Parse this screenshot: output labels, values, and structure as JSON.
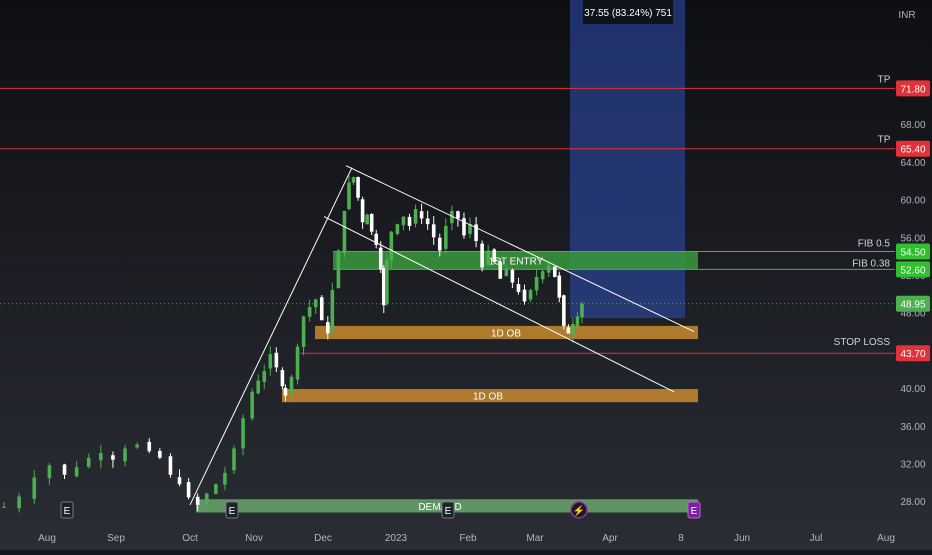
{
  "chart_data": {
    "type": "candlestick",
    "currency": "INR",
    "ylim": [
      26,
      78
    ],
    "y_ticks": [
      "28.00",
      "32.00",
      "36.00",
      "40.00",
      "44.00",
      "48.00",
      "52.00",
      "56.00",
      "60.00",
      "64.00",
      "68.00"
    ],
    "x_ticks": [
      "Aug",
      "Sep",
      "Oct",
      "Nov",
      "Dec",
      "2023",
      "Feb",
      "Mar",
      "Apr",
      "8",
      "Jun",
      "Jul",
      "Aug"
    ],
    "last_price": "48.95",
    "price_path": [
      [
        0,
        27.4
      ],
      [
        10,
        28.5
      ],
      [
        20,
        30.5
      ],
      [
        30,
        31.8
      ],
      [
        40,
        30.8
      ],
      [
        48,
        31.6
      ],
      [
        56,
        32.6
      ],
      [
        64,
        33.1
      ],
      [
        72,
        32.4
      ],
      [
        80,
        33.6
      ],
      [
        88,
        34.0
      ],
      [
        96,
        33.3
      ],
      [
        103,
        32.6
      ],
      [
        110,
        30.8
      ],
      [
        116,
        29.8
      ],
      [
        122,
        28.4
      ],
      [
        128,
        27.6
      ],
      [
        134,
        28.8
      ],
      [
        140,
        29.8
      ],
      [
        146,
        31.0
      ],
      [
        152,
        33.6
      ],
      [
        158,
        36.8
      ],
      [
        164,
        39.6
      ],
      [
        168,
        40.8
      ],
      [
        172,
        41.8
      ],
      [
        176,
        43.6
      ],
      [
        180,
        42.2
      ],
      [
        184,
        40.2
      ],
      [
        186,
        39.2
      ],
      [
        190,
        41.2
      ],
      [
        194,
        44.4
      ],
      [
        198,
        47.6
      ],
      [
        202,
        48.6
      ],
      [
        206,
        49.4
      ],
      [
        210,
        47.2
      ],
      [
        214,
        45.8
      ],
      [
        217,
        50.4
      ],
      [
        221,
        54.6
      ],
      [
        225,
        58.8
      ],
      [
        228,
        61.8
      ],
      [
        231,
        62.4
      ],
      [
        234,
        60.2
      ],
      [
        237,
        57.6
      ],
      [
        240,
        58.4
      ],
      [
        243,
        56.6
      ],
      [
        246,
        55.2
      ],
      [
        249,
        52.6
      ],
      [
        251,
        48.8
      ],
      [
        253,
        53.6
      ],
      [
        256,
        56.6
      ],
      [
        260,
        57.4
      ],
      [
        264,
        58.2
      ],
      [
        268,
        57.2
      ],
      [
        272,
        59.0
      ],
      [
        276,
        58.0
      ],
      [
        280,
        57.4
      ],
      [
        284,
        56.0
      ],
      [
        288,
        54.6
      ],
      [
        292,
        57.2
      ],
      [
        296,
        58.8
      ],
      [
        300,
        58.0
      ],
      [
        304,
        56.2
      ],
      [
        308,
        57.4
      ],
      [
        312,
        55.6
      ],
      [
        316,
        52.8
      ],
      [
        320,
        54.6
      ],
      [
        324,
        53.4
      ],
      [
        328,
        51.6
      ],
      [
        332,
        52.6
      ],
      [
        336,
        51.2
      ],
      [
        340,
        50.2
      ],
      [
        344,
        49.2
      ],
      [
        348,
        50.4
      ],
      [
        352,
        51.8
      ],
      [
        356,
        52.4
      ],
      [
        360,
        53.0
      ],
      [
        364,
        51.8
      ],
      [
        367,
        49.6
      ],
      [
        370,
        46.6
      ],
      [
        373,
        45.8
      ],
      [
        376,
        46.8
      ],
      [
        379,
        47.6
      ],
      [
        382,
        48.95
      ]
    ],
    "annotations": {
      "tp_lines": [
        {
          "label": "TP",
          "value": "71.80",
          "y": 71.8
        },
        {
          "label": "TP",
          "value": "65.40",
          "y": 65.4
        }
      ],
      "fib_levels": [
        {
          "label": "FIB 0.5",
          "value": "54.50",
          "y": 54.5
        },
        {
          "label": "FIB 0.38",
          "value": "52.60",
          "y": 52.6
        }
      ],
      "stop_loss": {
        "label": "STOP LOSS",
        "value": "43.70",
        "y": 43.7
      },
      "zones": [
        {
          "label": "1ST ENTRY",
          "y_low": 52.6,
          "y_high": 54.5,
          "color": "#3a9a3c"
        },
        {
          "label": "1D OB",
          "y_low": 45.2,
          "y_high": 46.6,
          "color": "#c88a2e"
        },
        {
          "label": "1D OB",
          "y_low": 38.5,
          "y_high": 39.9,
          "color": "#c88a2e"
        },
        {
          "label": "DEMAND",
          "y_low": 26.8,
          "y_high": 28.2,
          "color": "#6aa86c"
        }
      ],
      "measure_label": "37.55 (83.24%) 751",
      "event_markers": [
        "E",
        "E",
        "E",
        "⚡",
        "E"
      ]
    }
  }
}
